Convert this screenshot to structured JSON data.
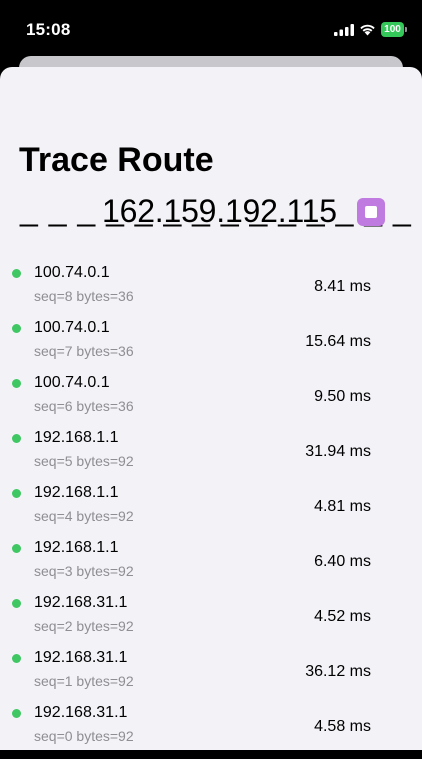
{
  "status_bar": {
    "time": "15:08",
    "battery": "100",
    "icons": [
      "signal-icon",
      "wifi-icon",
      "battery-icon"
    ]
  },
  "header": {
    "title": "Trace Route"
  },
  "target": {
    "dashes": "_ _ _ _ _ _ _ _ _ _ _ _ _ _",
    "host": "162.159.192.115"
  },
  "controls": {
    "stop_icon": "stop-icon",
    "accent_color": "#c07be0"
  },
  "status_color": "#3ec762",
  "hops": [
    {
      "ip": "100.74.0.1",
      "meta": "seq=8 bytes=36",
      "time": "8.41 ms"
    },
    {
      "ip": "100.74.0.1",
      "meta": "seq=7 bytes=36",
      "time": "15.64 ms"
    },
    {
      "ip": "100.74.0.1",
      "meta": "seq=6 bytes=36",
      "time": "9.50 ms"
    },
    {
      "ip": "192.168.1.1",
      "meta": "seq=5 bytes=92",
      "time": "31.94 ms"
    },
    {
      "ip": "192.168.1.1",
      "meta": "seq=4 bytes=92",
      "time": "4.81 ms"
    },
    {
      "ip": "192.168.1.1",
      "meta": "seq=3 bytes=92",
      "time": "6.40 ms"
    },
    {
      "ip": "192.168.31.1",
      "meta": "seq=2 bytes=92",
      "time": "4.52 ms"
    },
    {
      "ip": "192.168.31.1",
      "meta": "seq=1 bytes=92",
      "time": "36.12 ms"
    },
    {
      "ip": "192.168.31.1",
      "meta": "seq=0 bytes=92",
      "time": "4.58 ms"
    }
  ]
}
